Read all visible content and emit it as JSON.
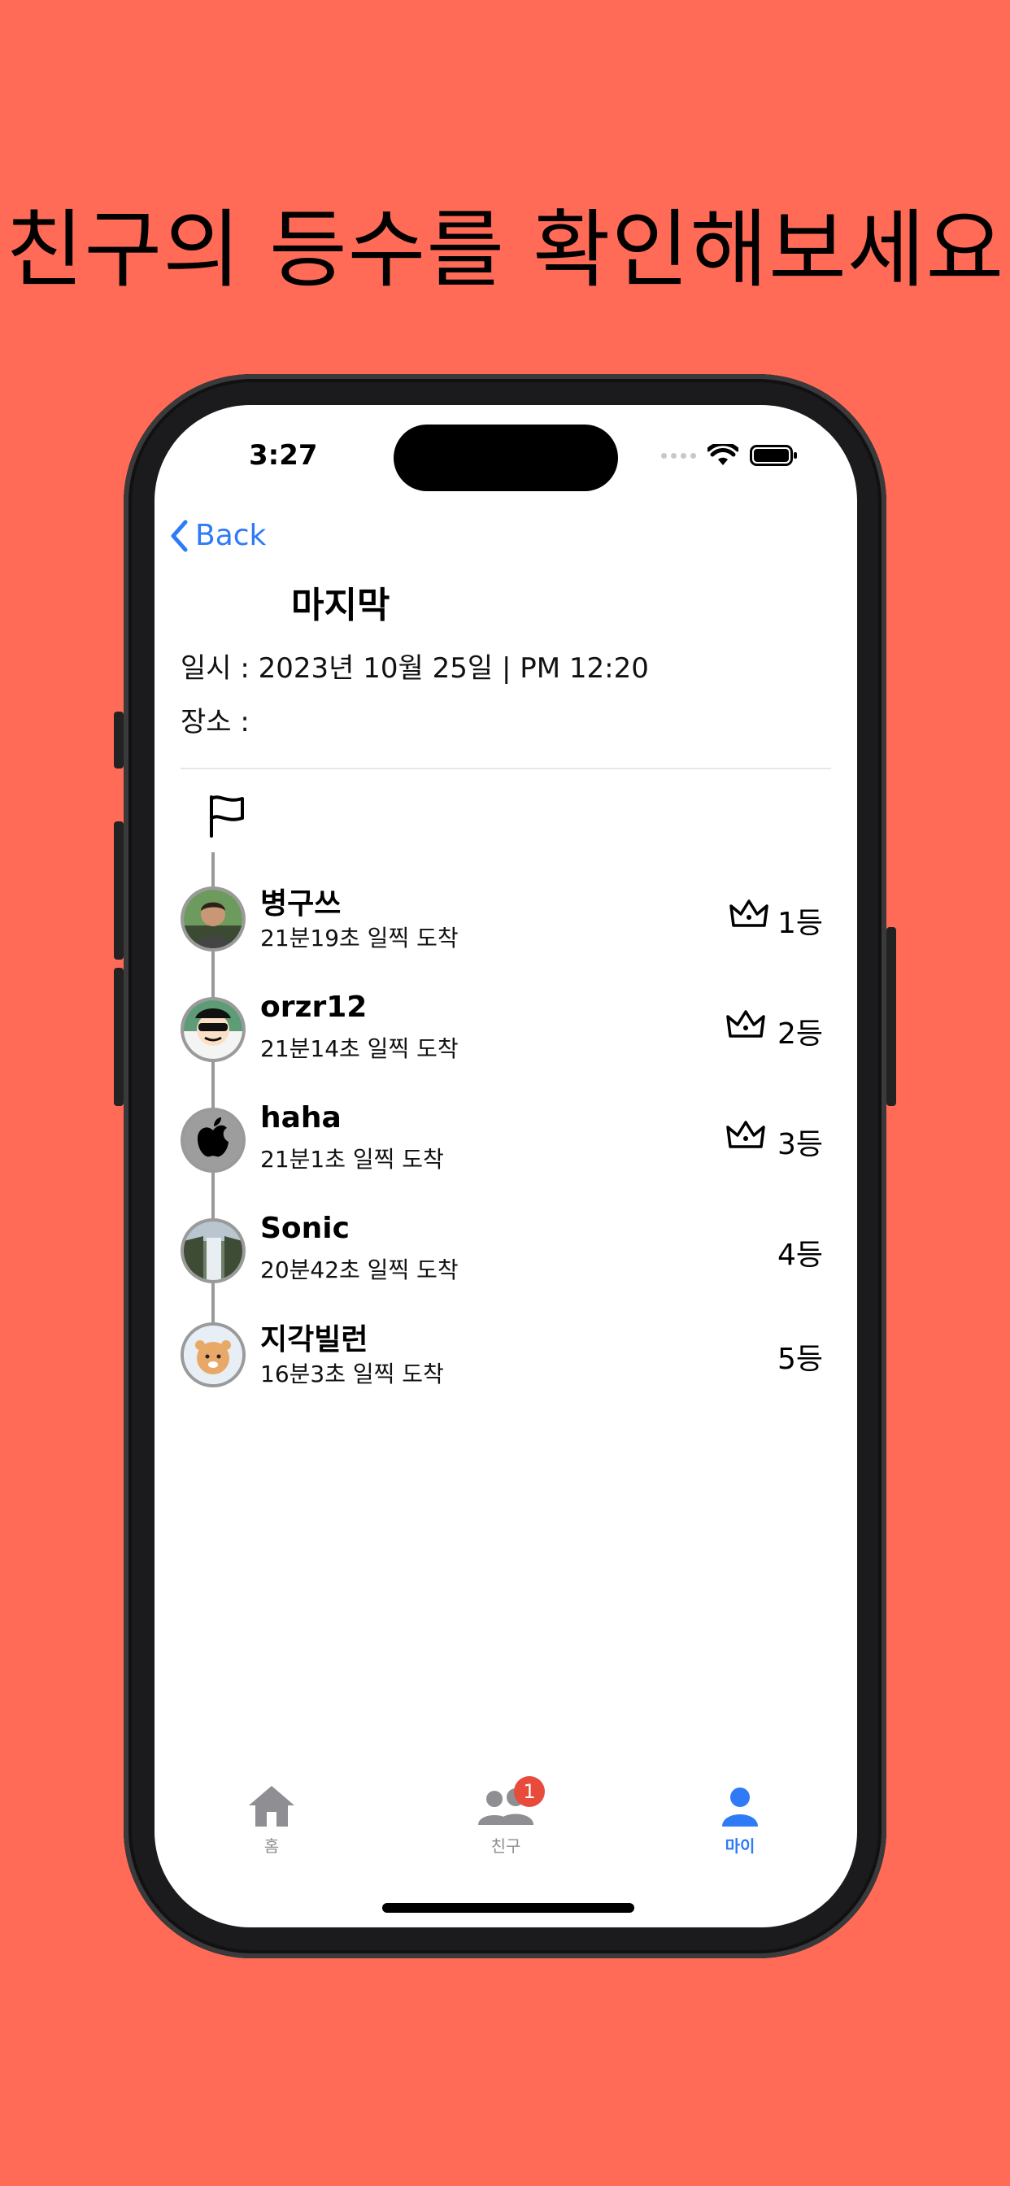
{
  "headline": "친구의 등수를 확인해보세요",
  "status_bar": {
    "time": "3:27"
  },
  "nav": {
    "back_label": "Back"
  },
  "meeting": {
    "title": "마지막",
    "date_line": "일시 : 2023년 10월 25일 | PM 12:20",
    "place_line": "장소 :"
  },
  "ranking": [
    {
      "name": "병구쓰",
      "arrival": "21분19초 일찍 도착",
      "rank": "1등",
      "crown": true,
      "avatar": "avatar-photo-person"
    },
    {
      "name": "orzr12",
      "arrival": "21분14초 일찍 도착",
      "rank": "2등",
      "crown": true,
      "avatar": "avatar-cartoon"
    },
    {
      "name": "haha",
      "arrival": "21분1초 일찍 도착",
      "rank": "3등",
      "crown": true,
      "avatar": "avatar-apple-logo"
    },
    {
      "name": "Sonic",
      "arrival": "20분42초 일찍 도착",
      "rank": "4등",
      "crown": false,
      "avatar": "avatar-waterfall"
    },
    {
      "name": "지각빌런",
      "arrival": "16분3초 일찍 도착",
      "rank": "5등",
      "crown": false,
      "avatar": "avatar-character"
    }
  ],
  "tabbar": {
    "home_label": "홈",
    "friends_label": "친구",
    "friends_badge": "1",
    "my_label": "마이"
  },
  "colors": {
    "background": "#FF6B57",
    "accent": "#2F7BF6",
    "badge": "#E84A3C"
  }
}
